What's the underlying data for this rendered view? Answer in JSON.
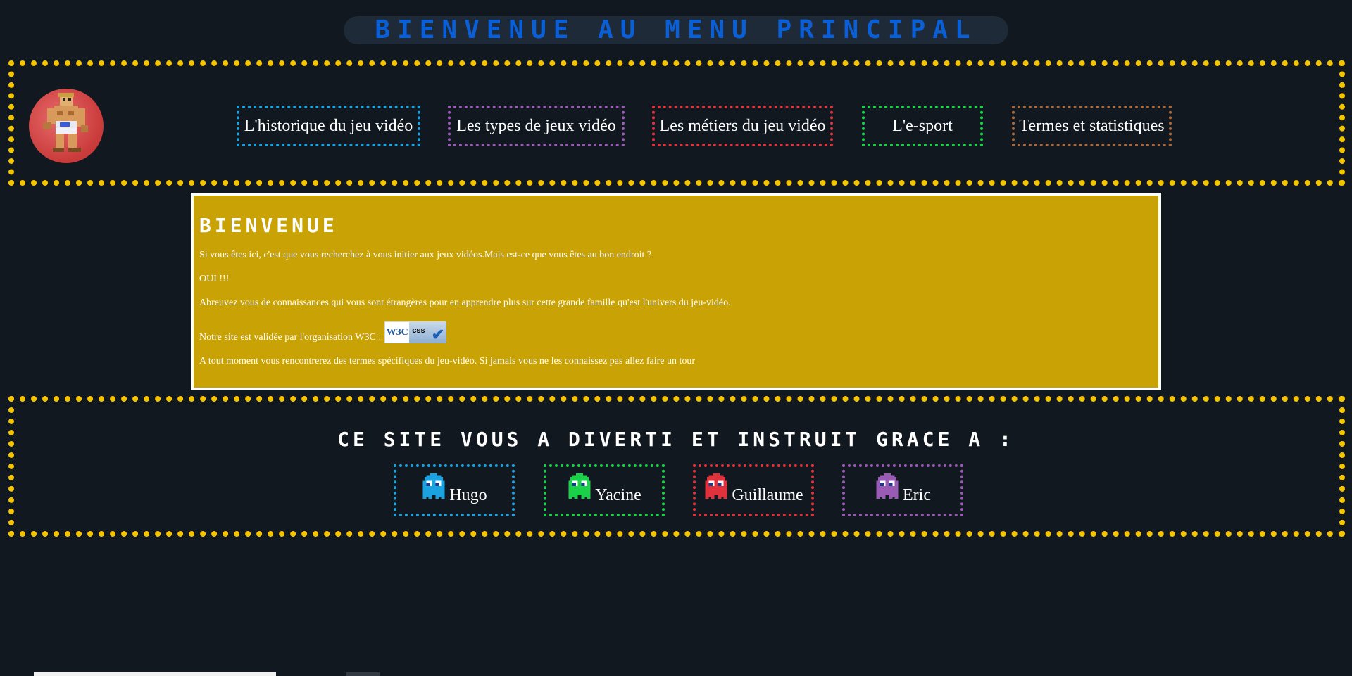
{
  "page_title": "BIENVENUE AU MENU PRINCIPAL",
  "nav": [
    {
      "label": "L'historique du jeu vidéo",
      "color": "#1aa3e0"
    },
    {
      "label": "Les types de jeux vidéo",
      "color": "#9a5bb5"
    },
    {
      "label": "Les métiers du jeu vidéo",
      "color": "#e0323c"
    },
    {
      "label": "L'e-sport",
      "color": "#1bd14a"
    },
    {
      "label": "Termes et statistiques",
      "color": "#a8693e"
    }
  ],
  "welcome": {
    "title": "BIENVENUE",
    "p1": "Si vous êtes ici, c'est que vous recherchez à vous initier aux jeux vidéos.Mais est-ce que vous êtes au bon endroit ?",
    "p2": "OUI !!!",
    "p3": "Abreuvez vous de connaissances qui vous sont étrangères pour en apprendre plus sur cette grande famille qu'est l'univers du jeu-vidéo.",
    "p4": "Notre site est validée par l'organisation W3C :",
    "badge_left": "W3C",
    "badge_right": "css",
    "p5": "A tout moment vous rencontrerez des termes spécifiques du jeu-vidéo. Si jamais vous ne les connaissez pas allez faire un tour"
  },
  "credits": {
    "title": "CE SITE VOUS A DIVERTI ET INSTRUIT GRACE A :",
    "authors": [
      {
        "name": "Hugo",
        "color": "#1aa3e0",
        "icon": "ghost-icon"
      },
      {
        "name": "Yacine",
        "color": "#1bd14a",
        "icon": "ghost-icon"
      },
      {
        "name": "Guillaume",
        "color": "#e0323c",
        "icon": "ghost-icon"
      },
      {
        "name": "Eric",
        "color": "#9a5bb5",
        "icon": "ghost-icon"
      }
    ]
  },
  "colors": {
    "background": "#111820",
    "dots": "#f5c400",
    "title_blue": "#0a5fd6",
    "welcome_bg": "#c9a206"
  }
}
